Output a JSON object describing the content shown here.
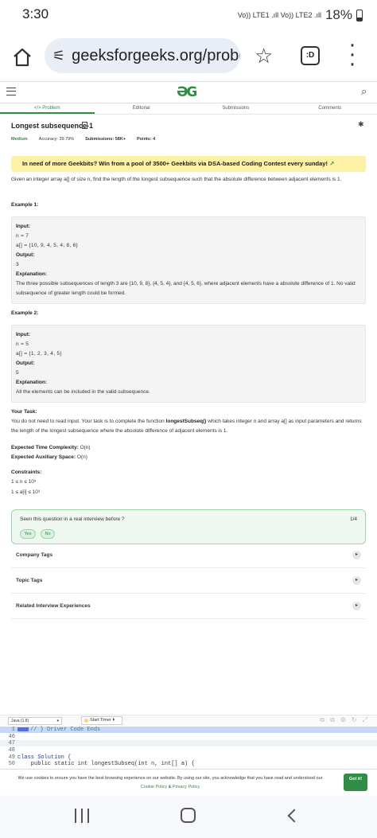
{
  "status_bar": {
    "time": "3:30",
    "network": "Vo)) LTE1 .ıll Vo)) LTE2 .ıll",
    "battery": "18%"
  },
  "browser": {
    "url": "geeksforgeeks.org/probl",
    "tab_label": ":D"
  },
  "header": {
    "logo": "ƏG"
  },
  "tabs": [
    "</> Problem",
    "Editorial",
    "Submissions",
    "Comments"
  ],
  "problem": {
    "title": "Longest subsequence-1",
    "difficulty": "Medium",
    "accuracy": "Accuracy: 39.79%",
    "submissions": "Submissions: 58K+",
    "points": "Points: 4",
    "banner": "In need of more Geekbits? Win from a pool of 3500+ Geekbits via DSA-based Coding Contest every sunday!",
    "description": "Given an integer array a[] of size n, find the length of the longest subsequence such that the absolute difference between adjacent elements is 1.",
    "example1_title": "Example 1:",
    "example1": {
      "input_label": "Input:",
      "line1": "n = 7",
      "line2": "a[] = {10, 9, 4, 5, 4, 8, 6}",
      "output_label": "Output:",
      "output": "3",
      "explanation_label": "Explanation:",
      "explanation": "The three possible subsequences of length 3 are {10, 9, 8}, {4, 5, 4}, and {4, 5, 6}, where adjacent elements have a absolute difference of 1. No valid subsequence of greater length could be formed."
    },
    "example2_title": "Example 2:",
    "example2": {
      "input_label": "Input:",
      "line1": "n = 5",
      "line2": "a[] = {1, 2, 3, 4, 5}",
      "output_label": "Output:",
      "output": "5",
      "explanation_label": "Explanation:",
      "explanation": "All the elements can be included in the valid subsequence."
    },
    "task_title": "Your Task:",
    "task_text_1": "You do not need to read input. Your task is to complete the function ",
    "task_fn": "longestSubseq()",
    "task_text_2": " which takes integer n and array a[] as input parameters and returns the length of the longest subsequence where the absolute difference of adjacent elements is 1.",
    "time_label": "Expected Time Complexity:",
    "time_value": "O(n)",
    "space_label": "Expected Auxiliary Space:",
    "space_value": "O(n)",
    "constraints_title": "Constraints:",
    "constraint1": "1 ≤ n ≤ 10³",
    "constraint2": "1 ≤ a[i] ≤ 10³"
  },
  "interview_card": {
    "question": "Seen this question in a real interview before ?",
    "count": "1/4",
    "yes": "Yes",
    "no": "No"
  },
  "accordions": [
    "Company Tags",
    "Topic Tags",
    "Related Interview Experiences"
  ],
  "editor": {
    "language": "Java (1.8)",
    "timer": "Start Timer",
    "lines": [
      {
        "num": "1",
        "text": "// } Driver Code Ends"
      },
      {
        "num": "46",
        "text": ""
      },
      {
        "num": "47",
        "text": ""
      },
      {
        "num": "48",
        "text": ""
      },
      {
        "num": "49",
        "text": "class Solution {"
      },
      {
        "num": "50",
        "text": "    public static int longestSubseq(int n, int[] a) {"
      }
    ]
  },
  "cookie": {
    "text_1": "We use cookies to ensure you have the best browsing experience on our website. By using our site, you acknowledge that you have read and understood our ",
    "policy": "Cookie Policy",
    "amp": " & ",
    "privacy": "Privacy Policy",
    "button": "Got it!"
  }
}
